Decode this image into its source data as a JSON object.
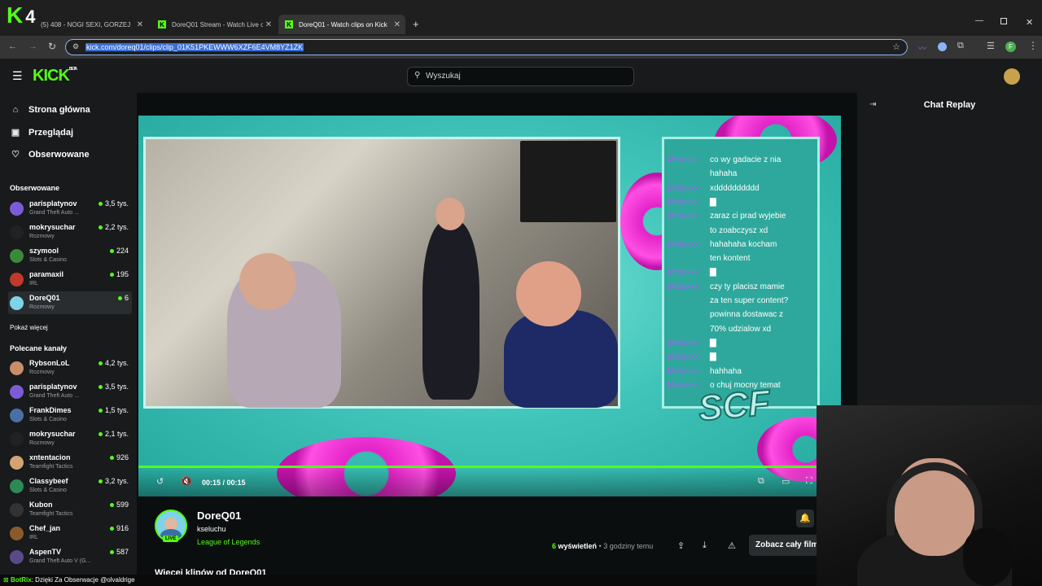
{
  "overlay_logo": {
    "brand": "K",
    "number": "4"
  },
  "browser": {
    "tabs": [
      {
        "label": "(5) 408 - NOGI SEXI, GORZEJ"
      },
      {
        "label": "DoreQ01 Stream - Watch Live o"
      },
      {
        "label": "DoreQ01 - Watch clips on Kick"
      }
    ],
    "new_tab": "+",
    "url": "kick.com/doreq01/clips/clip_01K51PKEWWW6XZF6E4VM8YZ1ZK"
  },
  "header": {
    "logo": "KICK",
    "logo_badge": "BETA",
    "search_placeholder": "Wyszukaj"
  },
  "sidebar": {
    "nav": [
      {
        "label": "Strona główna",
        "icon": "home-icon"
      },
      {
        "label": "Przeglądaj",
        "icon": "browse-icon"
      },
      {
        "label": "Obserwowane",
        "icon": "heart-icon"
      }
    ],
    "followed_title": "Obserwowane",
    "followed": [
      {
        "name": "parisplatynov",
        "category": "Grand Theft Auto ...",
        "viewers": "3,5 tys.",
        "color": "#7c5cd6"
      },
      {
        "name": "mokrysuchar",
        "category": "Rozmowy",
        "viewers": "2,2 tys.",
        "color": "#222222"
      },
      {
        "name": "szymool",
        "category": "Slots & Casino",
        "viewers": "224",
        "color": "#3a8a3a"
      },
      {
        "name": "paramaxil",
        "category": "IRL",
        "viewers": "195",
        "color": "#c0392b"
      },
      {
        "name": "DoreQ01",
        "category": "Rozmowy",
        "viewers": "6",
        "color": "#7fd3e8"
      }
    ],
    "show_more": "Pokaż więcej",
    "recommended_title": "Polecane kanały",
    "recommended": [
      {
        "name": "RybsonLoL",
        "category": "Rozmowy",
        "viewers": "4,2 tys.",
        "color": "#c98d6a"
      },
      {
        "name": "parisplatynov",
        "category": "Grand Theft Auto ...",
        "viewers": "3,5 tys.",
        "color": "#7c5cd6"
      },
      {
        "name": "FrankDimes",
        "category": "Slots & Casino",
        "viewers": "1,5 tys.",
        "color": "#4a6fa5"
      },
      {
        "name": "mokrysuchar",
        "category": "Rozmowy",
        "viewers": "2,1 tys.",
        "color": "#222222"
      },
      {
        "name": "xntentacion",
        "category": "Teamfight Tactics",
        "viewers": "926",
        "color": "#d4a373"
      },
      {
        "name": "Classybeef",
        "category": "Slots & Casino",
        "viewers": "3,2 tys.",
        "color": "#2d8a57"
      },
      {
        "name": "Kubon",
        "category": "Teamfight Tactics",
        "viewers": "599",
        "color": "#333333"
      },
      {
        "name": "Chef_jan",
        "category": "IRL",
        "viewers": "916",
        "color": "#8b5a2b"
      },
      {
        "name": "AspenTV",
        "category": "Grand Theft Auto V (G...",
        "viewers": "587",
        "color": "#5a4a8a"
      }
    ]
  },
  "video": {
    "overlay_chat": [
      {
        "user": "Misiakkk",
        "text": "co wy gadacie z nia"
      },
      {
        "user": "",
        "text": "hahaha"
      },
      {
        "user": "Misiakkk",
        "text": "xdddddddddd"
      },
      {
        "user": "Misiakkk",
        "text": "▇"
      },
      {
        "user": "Misiakkk",
        "text": "zaraz ci prad wyjebie"
      },
      {
        "user": "",
        "text": "to zoabczysz xd"
      },
      {
        "user": "Misiakkk",
        "text": "hahahaha kocham"
      },
      {
        "user": "",
        "text": "ten kontent"
      },
      {
        "user": "Misiakkk",
        "text": "▇"
      },
      {
        "user": "Misiakkk",
        "text": "czy ty placisz mamie"
      },
      {
        "user": "",
        "text": "za ten super content?"
      },
      {
        "user": "",
        "text": "powinna dostawac z"
      },
      {
        "user": "",
        "text": "70% udzialow xd"
      },
      {
        "user": "Misiakkk",
        "text": "▇"
      },
      {
        "user": "Misiakkk",
        "text": "▇"
      },
      {
        "user": "Misiakkk",
        "text": "hahhaha"
      },
      {
        "user": "Misiakkk",
        "text": "o chuj mocny temat"
      }
    ],
    "overlay_logo": "SCF",
    "time": "00:15 / 00:15",
    "progress": 1.0
  },
  "clip": {
    "streamer": "DoreQ01",
    "live": "LIVE",
    "title": "kseluchu",
    "category": "League of Legends",
    "views_count": "6",
    "views_label": "wyświetleń",
    "time_ago": "3 godziny temu",
    "full_button": "Zobacz cały film",
    "more_clips": "Więcej klipów od DoreQ01"
  },
  "chat_panel": {
    "title": "Chat Replay"
  },
  "ticker": {
    "bot": "BotRix",
    "text": ": Dzięki Za Obserwacje @olvaldrige"
  }
}
